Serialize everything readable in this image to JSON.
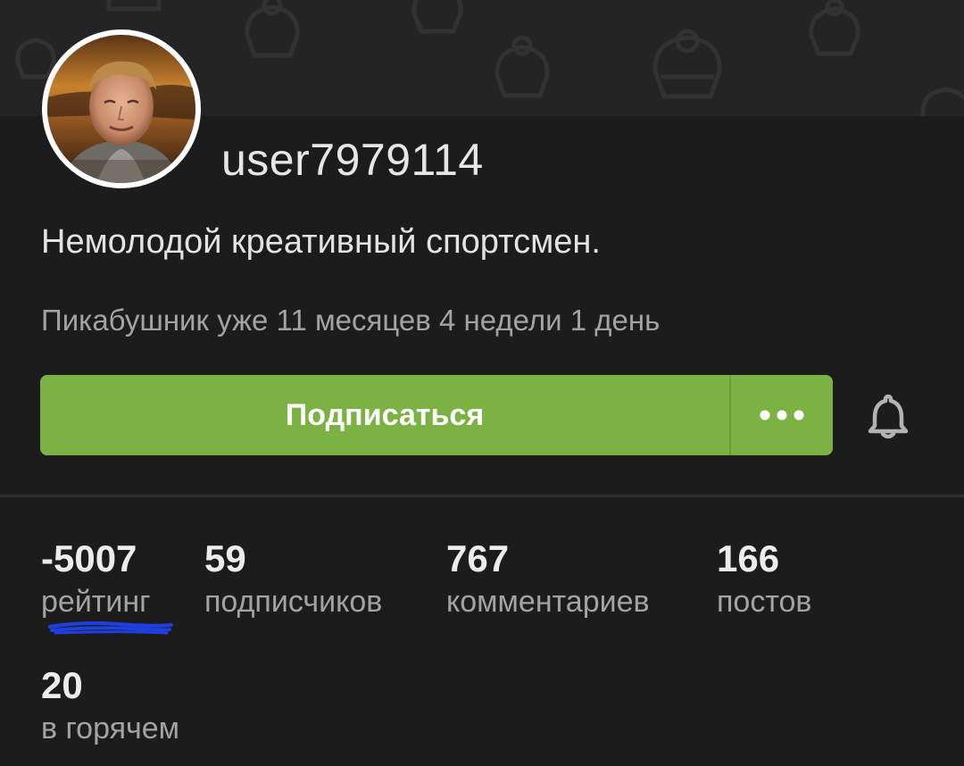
{
  "profile": {
    "username": "user7979114",
    "bio": "Немолодой креативный спортсмен.",
    "tenure": "Пикабушник уже 11 месяцев 4 недели 1 день"
  },
  "actions": {
    "subscribe_label": "Подписаться",
    "more_label": "•••"
  },
  "stats": [
    {
      "value": "-5007",
      "label": "рейтинг"
    },
    {
      "value": "59",
      "label": "подписчиков"
    },
    {
      "value": "767",
      "label": "комментариев"
    },
    {
      "value": "166",
      "label": "постов"
    },
    {
      "value": "20",
      "label": "в горячем"
    }
  ],
  "colors": {
    "background": "#1c1c1d",
    "banner": "#242425",
    "accent_green": "#7bb243",
    "text_primary": "#e6e6e6",
    "text_secondary": "#a3a3a5",
    "annotation_blue": "#1f3fe0"
  },
  "icons": {
    "bell": "bell-icon",
    "more": "more-dots-icon",
    "banner_pattern": "cupcake-pattern"
  }
}
